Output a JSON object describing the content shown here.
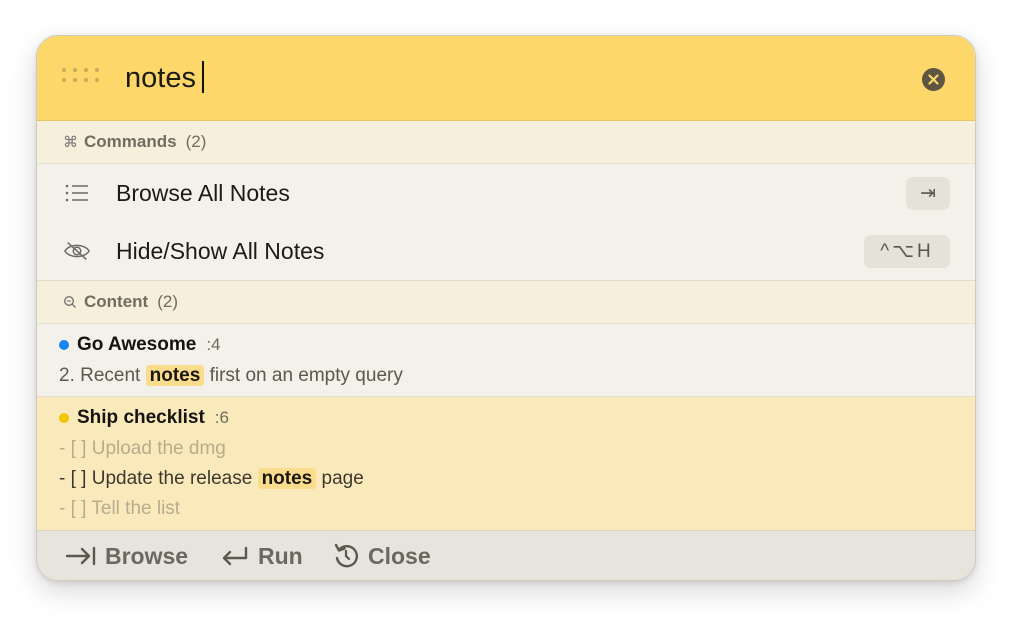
{
  "search": {
    "value": "notes",
    "placeholder": ""
  },
  "sections": {
    "commands": {
      "title": "Commands",
      "count": "(2)",
      "icon": "command-icon"
    },
    "content": {
      "title": "Content",
      "count": "(2)",
      "icon": "magnifier-icon"
    }
  },
  "commands": [
    {
      "label": "Browse All Notes",
      "icon": "list-icon",
      "shortcut": "⇥"
    },
    {
      "label": "Hide/Show All Notes",
      "icon": "eye-slash-icon",
      "shortcut": "^⌥H"
    }
  ],
  "results": [
    {
      "title": "Go Awesome",
      "line_ref": ":4",
      "dot_color": "#1b84f0",
      "lines": [
        {
          "before": "2. Recent ",
          "match": "notes",
          "after": " first on an empty query"
        }
      ]
    },
    {
      "title": "Ship checklist",
      "line_ref": ":6",
      "dot_color": "#f5c400",
      "lines": [
        {
          "text": "- [ ] Upload the dmg"
        },
        {
          "before": "- [ ] Update the release ",
          "match": "notes",
          "after": " page"
        },
        {
          "text": "- [ ] Tell the list"
        }
      ]
    }
  ],
  "footer": {
    "browse": "Browse",
    "run": "Run",
    "close": "Close"
  },
  "colors": {
    "search_bar": "#fdd76a",
    "selected_row": "#faeabb",
    "match_highlight": "#fbdc8c"
  }
}
